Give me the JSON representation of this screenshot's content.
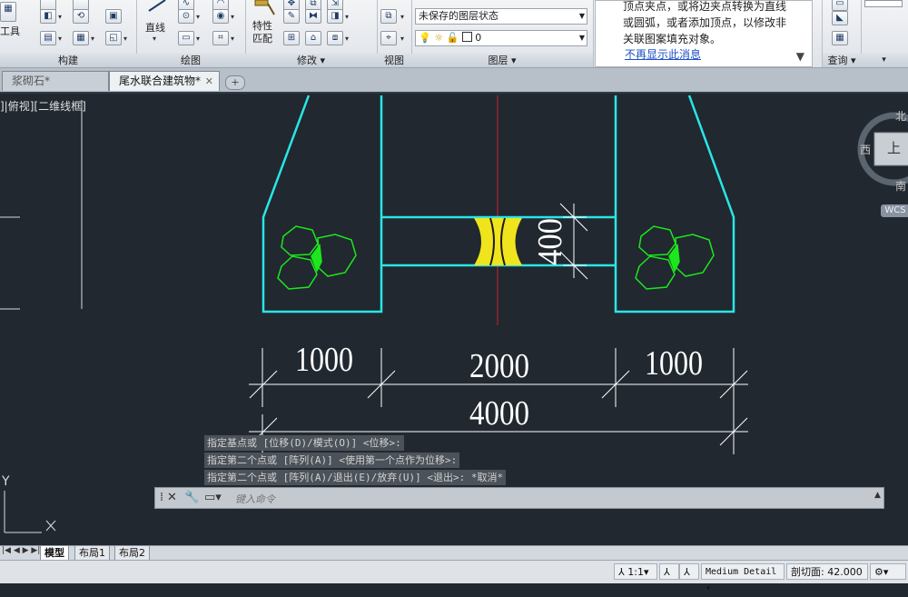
{
  "ribbon": {
    "panels": [
      {
        "label": "构建"
      },
      {
        "label": "绘图"
      },
      {
        "label": "修改 ▾"
      },
      {
        "label": "视图"
      },
      {
        "label": "图层 ▾"
      },
      {
        "label": "查询 ▾"
      }
    ],
    "tools_label": "工具",
    "line_label": "直线",
    "properties_label": "特性\n匹配",
    "layer_state": "未保存的图层状态",
    "layer_current": "0",
    "notice": {
      "message": "顶点夹点，或将边夹点转换为直线或圆弧，或者添加顶点，以修改非关联图案填充对象。",
      "link": "不再显示此消息"
    }
  },
  "tabs": [
    {
      "label": "浆砌石*",
      "active": false
    },
    {
      "label": "尾水联合建筑物*",
      "active": true
    }
  ],
  "viewport_label": "]|俯视][二维线框]",
  "viewcube": {
    "north": "北",
    "south": "南",
    "west": "西",
    "top": "上",
    "wcs": "WCS"
  },
  "drawing": {
    "dims": {
      "d1": "1000",
      "d2": "2000",
      "d3": "1000",
      "total": "4000",
      "vertical": "400"
    }
  },
  "command_history": [
    "指定基点或 [位移(D)/模式(O)] <位移>:",
    "指定第二个点或 [阵列(A)] <使用第一个点作为位移>:",
    "指定第二个点或 [阵列(A)/退出(E)/放弃(U)] <退出>: *取消*"
  ],
  "command_input_placeholder": "键入命令",
  "layout_tabs": [
    {
      "label": "模型",
      "active": true
    },
    {
      "label": "布局1",
      "active": false
    },
    {
      "label": "布局2",
      "active": false
    }
  ],
  "statusbar": {
    "scale": "1:1",
    "detail": "Medium Detail",
    "section_label": "剖切面:",
    "section_value": "42.000"
  },
  "colors": {
    "background": "#212830",
    "outline": "#29e6e6",
    "centerline": "#d1202a",
    "hatch": "#f0e41c",
    "stones": "#1de61d",
    "dim": "#ffffff"
  }
}
